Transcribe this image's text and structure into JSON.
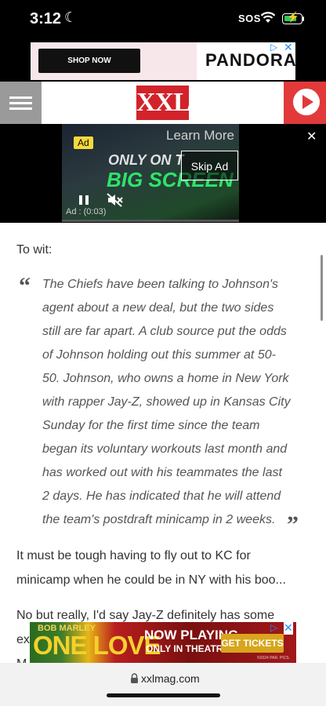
{
  "status_bar": {
    "time": "3:12",
    "sos": "SOS"
  },
  "top_ad": {
    "button_label": "SHOP NOW",
    "brand": "PANDORA"
  },
  "header": {
    "logo_text": "XXL"
  },
  "video_ad": {
    "badge": "Ad",
    "learn_more": "Learn More",
    "skip_label": "Skip Ad",
    "timer": "Ad : (0:03)",
    "line1": "ONLY ON T",
    "line2": "BIG SCREEN"
  },
  "article": {
    "intro": "To wit:",
    "quote_lines": [
      "The Chiefs have been talking to Johnson's",
      "agent about a new deal, but the two sides",
      "still are far apart. A club source put the odds",
      "of Johnson holding out this summer at 50-",
      "50. Johnson, who owns a home in New York",
      "with rapper Jay-Z, showed up in Kansas City",
      "Sunday for the first time since the team",
      "began its voluntary workouts last month and",
      "has worked out with his teammates the last",
      "2 days. He has indicated that he will attend",
      "the team's postdraft minicamp in 2 weeks."
    ],
    "para1_lines": [
      "It must be tough having to fly out to KC for",
      "minicamp when he could be in NY with his boo..."
    ],
    "para2_lines": [
      "No but really, I'd say Jay-Z definitely has some",
      "ex",
      "M"
    ]
  },
  "bottom_ad": {
    "artist": "BOB MARLEY",
    "title": "ONE LOVE",
    "now_playing": "NOW PLAYING",
    "theatres": "ONLY IN THEATRES",
    "tickets": "GET TICKETS",
    "fine_print": "©2024 PAR. PICS."
  },
  "browser": {
    "url": "xxlmag.com"
  }
}
